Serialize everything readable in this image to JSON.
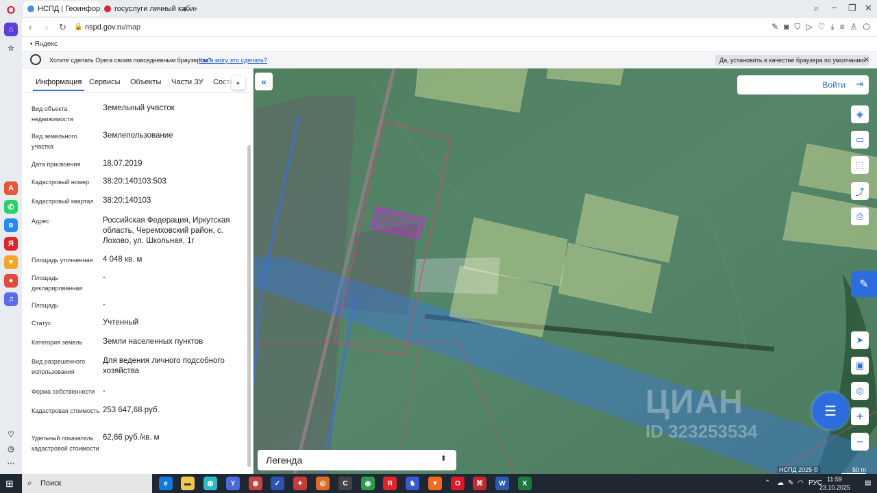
{
  "browser": {
    "tabs": [
      {
        "title": "НСПД | Геоинформацио",
        "active": true
      },
      {
        "title": "госуслуги личный кабин",
        "active": false
      }
    ],
    "url_host": "nspd.gov.ru",
    "url_path": "/map",
    "bookmark": "Яндекс",
    "banner": {
      "message": "Хотите сделать Opera своим повседневным браузером?",
      "link": "Как я могу это сделать?",
      "button": "Да, установить в качестве браузера по умолчанию"
    }
  },
  "panel": {
    "tabs": [
      "Информация",
      "Сервисы",
      "Объекты",
      "Части ЗУ",
      "Соста"
    ],
    "active_tab": "Информация",
    "rows": [
      {
        "label": "Вид объекта недвижимости",
        "value": "Земельный участок"
      },
      {
        "label": "Вид земельного участка",
        "value": "Землепользование"
      },
      {
        "label": "Дата присвоения",
        "value": "18.07.2019"
      },
      {
        "label": "Кадастровый номер",
        "value": "38:20:140103:503"
      },
      {
        "label": "Кадастровый квартал",
        "value": "38:20:140103"
      },
      {
        "label": "Адрес",
        "value": "Российская Федерация, Иркутская область, Черемховский район, с. Лохово, ул. Школьная, 1г"
      },
      {
        "label": "Площадь уточненная",
        "value": "4 048 кв. м"
      },
      {
        "label": "Площадь декларированная",
        "value": "-"
      },
      {
        "label": "Площадь",
        "value": "-"
      },
      {
        "label": "Статус",
        "value": "Учтенный"
      },
      {
        "label": "Категория земель",
        "value": "Земли населенных пунктов"
      },
      {
        "label": "Вид разрешенного использования",
        "value": "Для ведения личного подсобного хозяйства"
      },
      {
        "label": "Форма собственности",
        "value": "-"
      },
      {
        "label": "Кадастровая стоимость",
        "value": "253 647,68 руб."
      },
      {
        "label": "Удельный показатель кадастровой стоимости",
        "value": "62,66 руб./кв. м"
      }
    ]
  },
  "map": {
    "login": "Войти",
    "legend": "Легенда",
    "attribution": "НСПД 2025 ©",
    "scale": "50 m",
    "watermark": {
      "brand": "ЦИАН",
      "id": "ID 323253534"
    },
    "colors": {
      "parcel_highlight": "#c030d0",
      "zone_blue": "#3a78d8",
      "field_fill": "#e8f0a0",
      "boundary": "#d04a70"
    }
  },
  "taskbar": {
    "search": "Поиск",
    "lang": "РУС",
    "time": "11:59",
    "date": "23.10.2025"
  }
}
